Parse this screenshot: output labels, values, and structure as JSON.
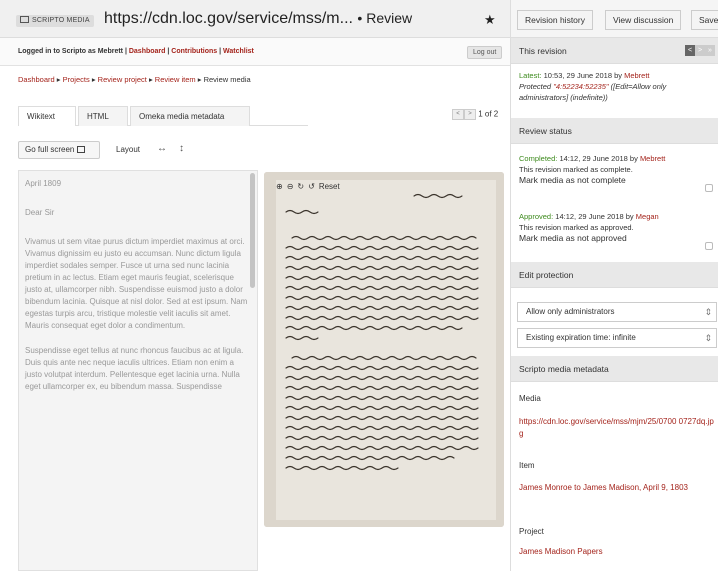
{
  "browser": {
    "brand": "SCRIPTO MEDIA",
    "url": "https://cdn.loc.gov/service/mss/m...",
    "page_suffix": "• Review"
  },
  "login": {
    "prefix": "Logged in to Scripto as Mebrett | ",
    "dashboard": "Dashboard",
    "sep1": " | ",
    "contributions": "Contributions",
    "sep2": " | ",
    "watchlist": "Watchlist",
    "logout": "Log out"
  },
  "breadcrumb": {
    "dashboard": "Dashboard",
    "projects": "Projects",
    "review_project": "Review project",
    "review_item": "Review item",
    "current": "Review media",
    "sep": " ▸ "
  },
  "tabs": [
    "Wikitext",
    "HTML",
    "Omeka media metadata"
  ],
  "pager": {
    "text": "1 of 2"
  },
  "toolbar": {
    "fullscreen": "Go full screen",
    "layout": "Layout",
    "layout_h_icon": "↔",
    "layout_v_icon": "↕"
  },
  "transcription": {
    "date": "April 1809",
    "greeting": "Dear Sir",
    "p1": "Vivamus ut sem vitae purus dictum imperdiet maximus at orci. Vivamus dignissim eu justo eu accumsan. Nunc dictum ligula imperdiet sodales semper. Fusce ut urna sed nunc lacinia pretium in ac lectus. Etiam eget mauris feugiat, scelerisque justo at, ullamcorper nibh. Suspendisse euismod justo a dolor bibendum lacinia. Quisque at nisl dolor. Sed at est ipsum. Nam egestas turpis arcu, tristique molestie velit iaculis sit amet. Mauris consequat eget dolor a condimentum.",
    "p2": "Suspendisse eget tellus at nunc rhoncus faucibus ac at ligula. Duis quis ante nec neque iaculis ultrices. Etiam non enim a justo volutpat interdum. Pellentesque eget lacinia urna. Nulla eget ullamcorper ex, eu bibendum massa. Suspendisse"
  },
  "viewer": {
    "zoom_in": "⊕",
    "zoom_out": "⊖",
    "rotate_cw": "↻",
    "rotate_ccw": "↺",
    "reset": "Reset"
  },
  "sidebar": {
    "buttons": {
      "revision_history": "Revision history",
      "view_discussion": "View discussion",
      "save": "Save"
    },
    "this_revision": {
      "heading": "This revision",
      "latest_label": "Latest:",
      "latest_text": " 10:53, 29 June 2018 by ",
      "latest_user": "Mebrett",
      "protected_label": "Protected ",
      "protected_link": "\"4:52234:52235\"",
      "protected_rest": " ([Edit=Allow only administrators] (indefinite))"
    },
    "review_status": {
      "heading": "Review status",
      "completed_label": "Completed:",
      "completed_text": " 14:12, 29 June 2018 by ",
      "completed_user": "Mebrett",
      "completed_note": "This revision marked as complete.",
      "mark_not_complete": "Mark media as not complete",
      "approved_label": "Approved:",
      "approved_text": " 14:12, 29 June 2018 by ",
      "approved_user": "Megan",
      "approved_note": "This revision marked as approved.",
      "mark_not_approved": "Mark media as not approved"
    },
    "edit_protection": {
      "heading": "Edit protection",
      "level": "Allow only administrators",
      "expiration": "Existing expiration time: infinite"
    },
    "metadata": {
      "heading": "Scripto media metadata",
      "media_label": "Media",
      "media_value": "https://cdn.loc.gov/service/mss/mjm/25/0700 0727dq.jpg",
      "item_label": "Item",
      "item_value": "James Monroe to James Madison, April 9, 1803",
      "project_label": "Project",
      "project_value": "James Madison Papers"
    }
  },
  "colors": {
    "link_red": "#a4241c",
    "status_green": "#3d8a1d",
    "header_gray": "#e8e8e8"
  }
}
